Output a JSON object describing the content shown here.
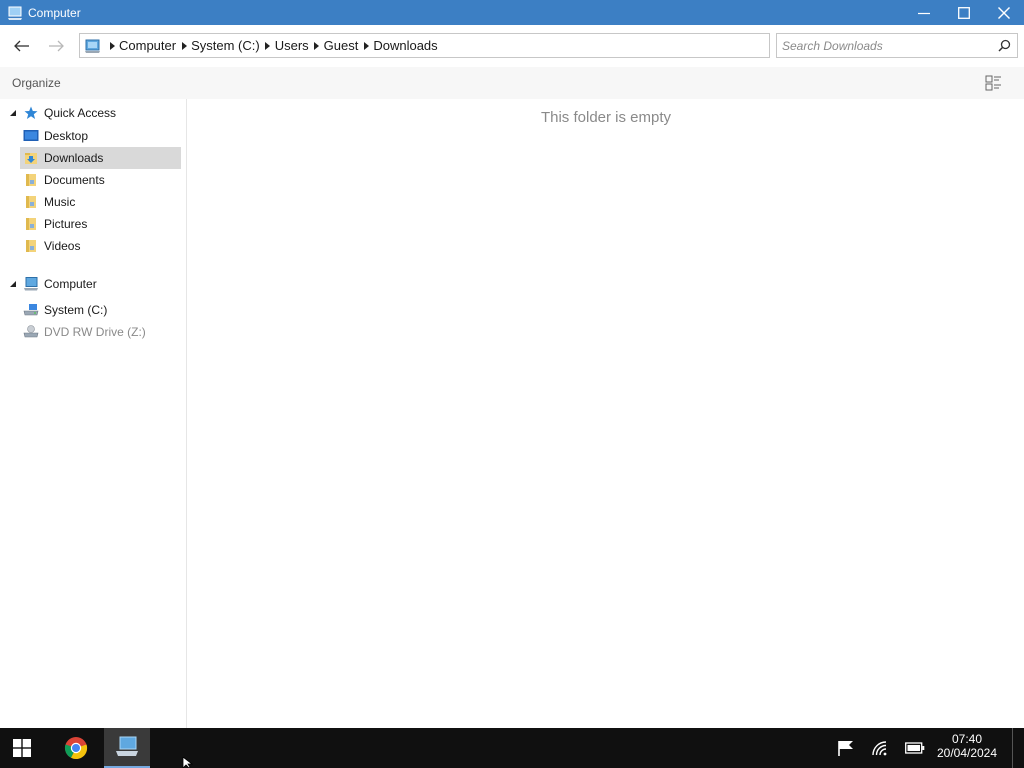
{
  "window": {
    "title": "Computer",
    "minimize_icon": "minimize-icon",
    "maximize_icon": "maximize-icon",
    "close_icon": "close-icon"
  },
  "nav": {
    "back_icon": "back-arrow-icon",
    "forward_icon": "forward-arrow-icon",
    "breadcrumbs": [
      "Computer",
      "System (C:)",
      "Users",
      "Guest",
      "Downloads"
    ],
    "search_placeholder": "Search Downloads"
  },
  "commandbar": {
    "organize_label": "Organize"
  },
  "sidebar": {
    "quick_access": {
      "label": "Quick Access",
      "items": [
        {
          "label": "Desktop",
          "icon": "desktop-icon"
        },
        {
          "label": "Downloads",
          "icon": "downloads-folder-icon",
          "selected": true
        },
        {
          "label": "Documents",
          "icon": "folder-icon"
        },
        {
          "label": "Music",
          "icon": "folder-icon"
        },
        {
          "label": "Pictures",
          "icon": "folder-icon"
        },
        {
          "label": "Videos",
          "icon": "folder-icon"
        }
      ]
    },
    "computer": {
      "label": "Computer",
      "items": [
        {
          "label": "System (C:)",
          "icon": "drive-icon"
        },
        {
          "label": "DVD RW Drive (Z:)",
          "icon": "dvd-drive-icon",
          "disabled": true
        }
      ]
    }
  },
  "content": {
    "empty_message": "This folder is empty"
  },
  "taskbar": {
    "time": "07:40",
    "date": "20/04/2024"
  },
  "colors": {
    "titlebar": "#3c7fc4",
    "selection": "#d9d9d9",
    "taskbar": "#101010"
  }
}
